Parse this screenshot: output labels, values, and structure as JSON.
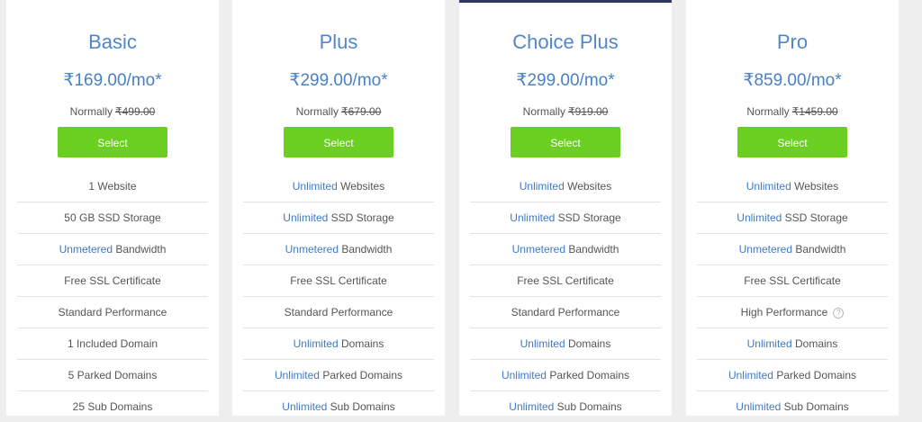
{
  "select_label": "Select",
  "normally_label": "Normally",
  "plans": [
    {
      "name": "Basic",
      "price": "₹169.00/mo*",
      "old_price": "₹499.00",
      "features": [
        {
          "hl": "",
          "text": "1 Website"
        },
        {
          "hl": "",
          "text": "50 GB SSD Storage"
        },
        {
          "hl": "Unmetered",
          "text": " Bandwidth"
        },
        {
          "hl": "",
          "text": "Free SSL Certificate"
        },
        {
          "hl": "",
          "text": "Standard Performance"
        },
        {
          "hl": "",
          "text": "1 Included Domain"
        },
        {
          "hl": "",
          "text": "5 Parked Domains"
        },
        {
          "hl": "",
          "text": "25 Sub Domains"
        }
      ]
    },
    {
      "name": "Plus",
      "price": "₹299.00/mo*",
      "old_price": "₹679.00",
      "features": [
        {
          "hl": "Unlimited",
          "text": " Websites"
        },
        {
          "hl": "Unlimited",
          "text": " SSD Storage"
        },
        {
          "hl": "Unmetered",
          "text": " Bandwidth"
        },
        {
          "hl": "",
          "text": "Free SSL Certificate"
        },
        {
          "hl": "",
          "text": "Standard Performance"
        },
        {
          "hl": "Unlimited",
          "text": " Domains"
        },
        {
          "hl": "Unlimited",
          "text": " Parked Domains"
        },
        {
          "hl": "Unlimited",
          "text": " Sub Domains"
        }
      ]
    },
    {
      "name": "Choice Plus",
      "price": "₹299.00/mo*",
      "old_price": "₹919.00",
      "features": [
        {
          "hl": "Unlimited",
          "text": " Websites"
        },
        {
          "hl": "Unlimited",
          "text": " SSD Storage"
        },
        {
          "hl": "Unmetered",
          "text": " Bandwidth"
        },
        {
          "hl": "",
          "text": "Free SSL Certificate"
        },
        {
          "hl": "",
          "text": "Standard Performance"
        },
        {
          "hl": "Unlimited",
          "text": " Domains"
        },
        {
          "hl": "Unlimited",
          "text": " Parked Domains"
        },
        {
          "hl": "Unlimited",
          "text": " Sub Domains"
        }
      ]
    },
    {
      "name": "Pro",
      "price": "₹859.00/mo*",
      "old_price": "₹1459.00",
      "features": [
        {
          "hl": "Unlimited",
          "text": " Websites"
        },
        {
          "hl": "Unlimited",
          "text": " SSD Storage"
        },
        {
          "hl": "Unmetered",
          "text": " Bandwidth"
        },
        {
          "hl": "",
          "text": "Free SSL Certificate"
        },
        {
          "hl": "",
          "text": "High Performance",
          "help": "?"
        },
        {
          "hl": "Unlimited",
          "text": " Domains"
        },
        {
          "hl": "Unlimited",
          "text": " Parked Domains"
        },
        {
          "hl": "Unlimited",
          "text": " Sub Domains"
        }
      ]
    }
  ],
  "colors": {
    "accent_blue": "#5187c9",
    "select_green": "#6acf21",
    "featured_border": "#2e3a59"
  }
}
